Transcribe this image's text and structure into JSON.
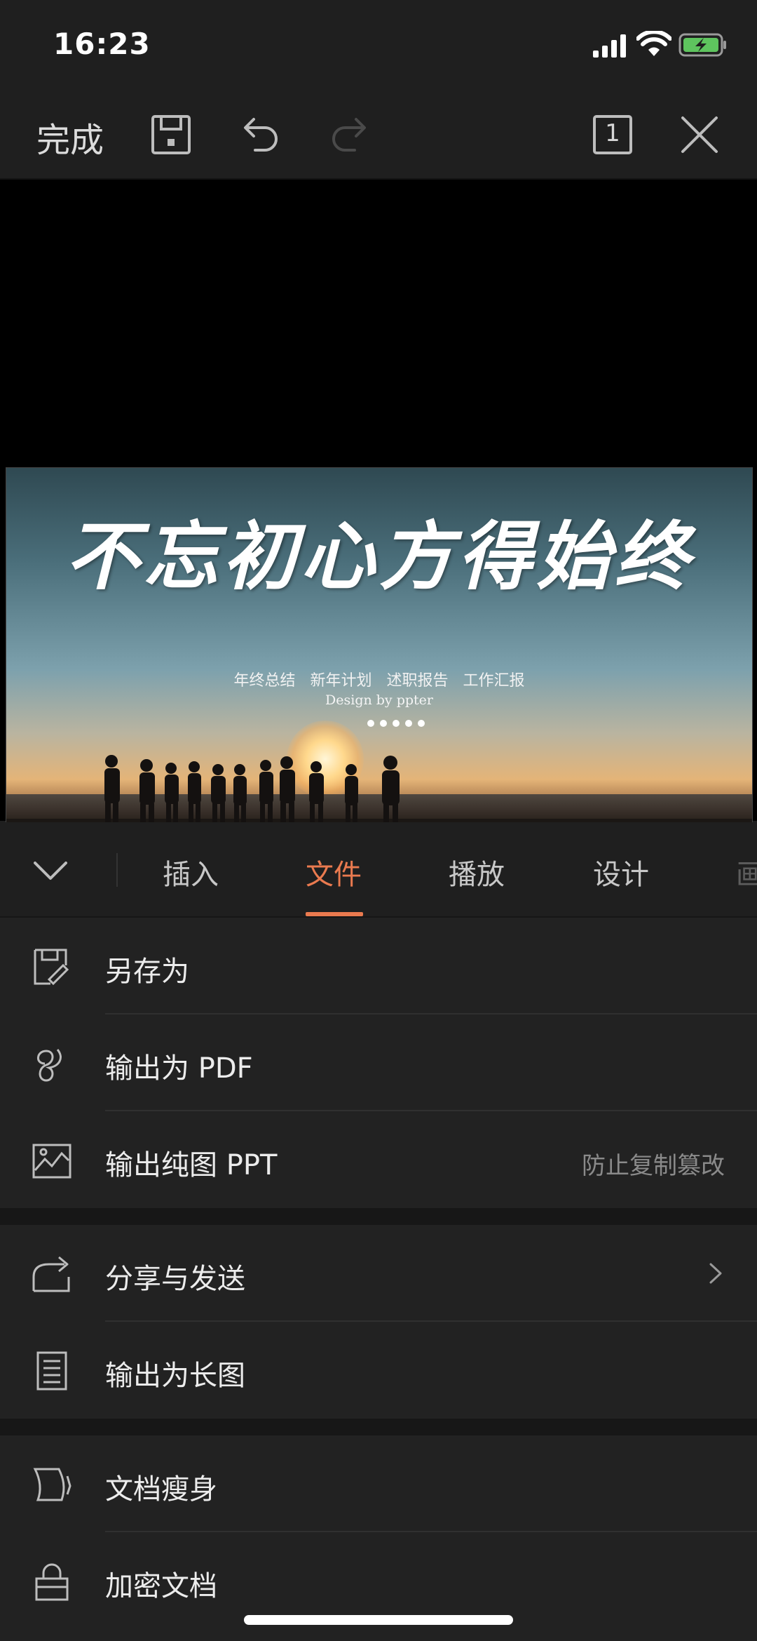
{
  "status": {
    "time": "16:23"
  },
  "toolbar": {
    "done_label": "完成",
    "slide_count": "1",
    "icons": [
      "save-icon",
      "undo-icon",
      "redo-icon",
      "slide-counter-icon",
      "close-icon"
    ]
  },
  "slide": {
    "headline": "不忘初心方得始终",
    "subline": "年终总结 新年计划 述职报告 工作汇报",
    "credit": "Design by ppter"
  },
  "tabs": {
    "items": [
      {
        "label": "插入",
        "state": "normal"
      },
      {
        "label": "文件",
        "state": "active"
      },
      {
        "label": "播放",
        "state": "normal"
      },
      {
        "label": "设计",
        "state": "normal"
      },
      {
        "label": "画",
        "state": "partial"
      }
    ],
    "accent_color": "#ea7a4f"
  },
  "menu": {
    "groups": [
      {
        "items": [
          {
            "label": "另存为",
            "icon": "save-as-icon"
          },
          {
            "label": "输出为 PDF",
            "icon": "pdf-export-icon"
          },
          {
            "label": "输出纯图 PPT",
            "icon": "image-export-icon",
            "hint": "防止复制篡改"
          }
        ]
      },
      {
        "items": [
          {
            "label": "分享与发送",
            "icon": "share-icon",
            "has_chevron": true
          },
          {
            "label": "输出为长图",
            "icon": "long-image-icon"
          }
        ]
      },
      {
        "items": [
          {
            "label": "文档瘦身",
            "icon": "slim-document-icon"
          },
          {
            "label": "加密文档",
            "icon": "lock-icon"
          }
        ]
      }
    ]
  }
}
